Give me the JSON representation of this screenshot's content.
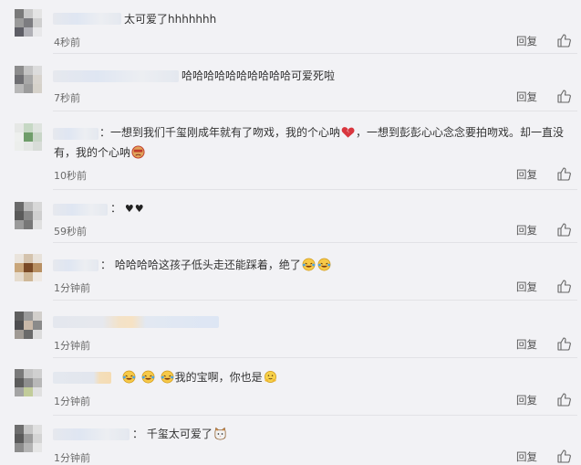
{
  "colors": {
    "background": "#f2f2f5",
    "divider": "#e2e2e6",
    "text": "#333333",
    "meta": "#6a6a6a"
  },
  "reply_label": "回复",
  "comments": [
    {
      "text": "太可爱了hhhhhhh",
      "time": "4秒前"
    },
    {
      "text": "哈哈哈哈哈哈哈哈哈哈可爱死啦",
      "time": "7秒前"
    },
    {
      "text_a": "：一想到我们千玺刚成年就有了吻戏，我的个心呐",
      "text_b": "，一想到彭彭心心念念要拍吻戏。却一直没有，我的个心呐",
      "time": "10秒前"
    },
    {
      "text": "：",
      "hearts": "♥♥",
      "time": "59秒前"
    },
    {
      "text": "：   哈哈哈哈这孩子低头走还能踩着，绝了",
      "time": "1分钟前"
    },
    {
      "text": "",
      "time": "1分钟前"
    },
    {
      "text": "我的宝啊，你也是",
      "time": "1分钟前"
    },
    {
      "text": "：   千玺太可爱了",
      "time": "1分钟前"
    }
  ]
}
